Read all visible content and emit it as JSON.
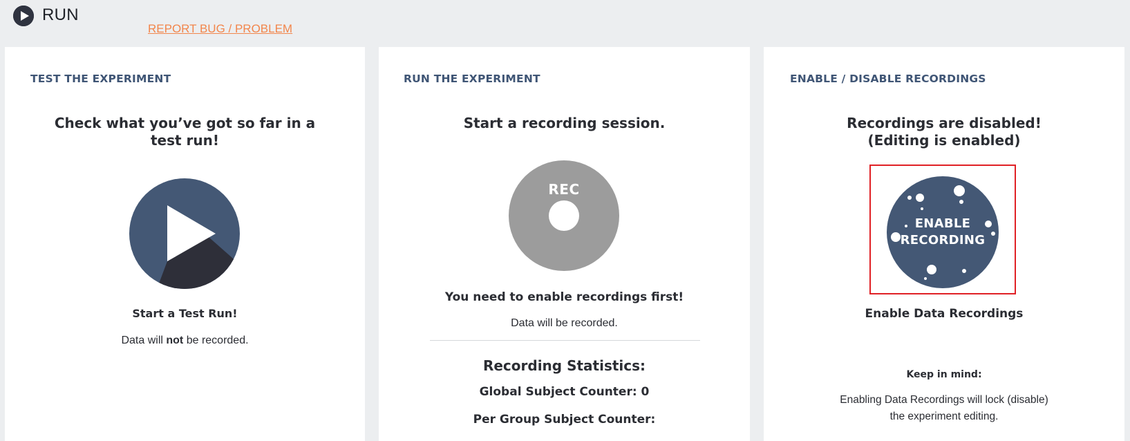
{
  "header": {
    "title": "RUN",
    "report_link": "REPORT BUG / PROBLEM"
  },
  "colors": {
    "accent_orange": "#f2864c",
    "heading_blue": "#3f5575",
    "button_blue": "#445875",
    "button_dark": "#2e2f39",
    "disabled_gray": "#9c9c9c",
    "highlight_red": "#e02025"
  },
  "cards": {
    "test": {
      "heading": "TEST THE EXPERIMENT",
      "headline_line1": "Check what you’ve got so far in a",
      "headline_line2": "test run!",
      "button_icon": "play-icon",
      "label": "Start a Test Run!",
      "note_prefix": "Data will ",
      "note_bold": "not",
      "note_suffix": " be recorded."
    },
    "run": {
      "heading": "RUN THE EXPERIMENT",
      "headline": "Start a recording session.",
      "button_text": "REC",
      "warning": "You need to enable recordings first!",
      "note": "Data will be recorded.",
      "stats_title": "Recording Statistics:",
      "global_counter": "Global Subject Counter: 0",
      "per_group_counter": "Per Group Subject Counter:"
    },
    "recordings": {
      "heading": "ENABLE / DISABLE RECORDINGS",
      "headline_line1": "Recordings are disabled!",
      "headline_line2": "(Editing is enabled)",
      "button_line1": "ENABLE",
      "button_line2": "RECORDING",
      "label": "Enable Data Recordings",
      "keep_in_mind": "Keep in mind:",
      "warning_line1": "Enabling Data Recordings will lock (disable)",
      "warning_line2": "the experiment editing."
    }
  }
}
